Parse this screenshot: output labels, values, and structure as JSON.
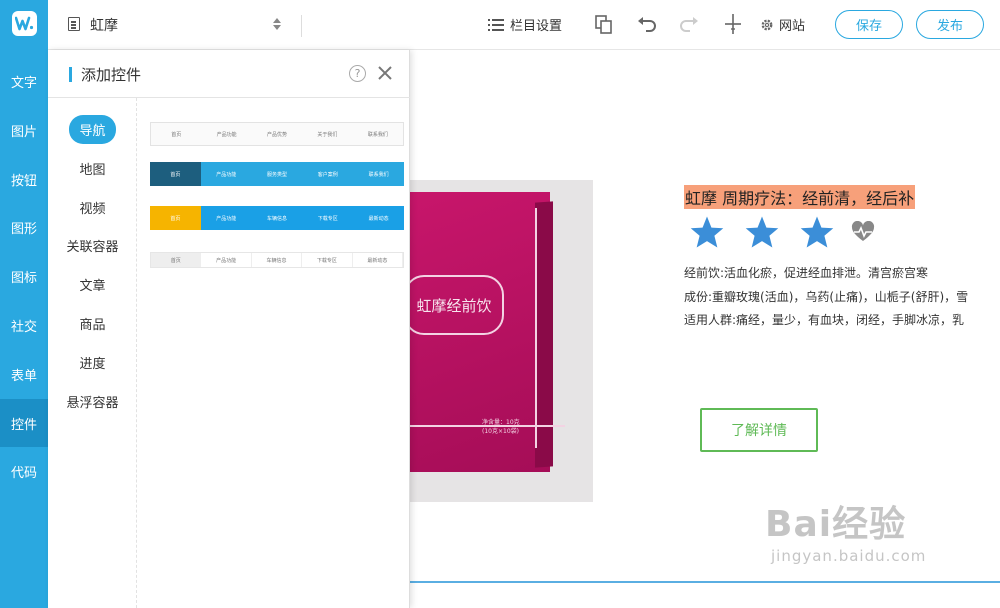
{
  "rail": {
    "items": [
      "文字",
      "图片",
      "按钮",
      "图形",
      "图标",
      "社交",
      "表单",
      "控件",
      "代码"
    ],
    "active": "控件",
    "accent": "#2aa8e0"
  },
  "topbar": {
    "doc_title": "虹摩",
    "column_settings": "栏目设置",
    "website": "网站",
    "save": "保存",
    "publish": "发布"
  },
  "panel": {
    "title": "添加控件",
    "help_symbol": "?",
    "categories": [
      "导航",
      "地图",
      "视频",
      "关联容器",
      "文章",
      "商品",
      "进度",
      "悬浮容器"
    ],
    "active_category": "导航",
    "nav_previews": [
      [
        "首页",
        "产品功能",
        "产品优势",
        "关于我们",
        "联系我们"
      ],
      [
        "首页",
        "产品功能",
        "服务类型",
        "客户案例",
        "联系我们"
      ],
      [
        "首页",
        "产品功能",
        "车辆信息",
        "下载专区",
        "最新动态"
      ],
      [
        "首页",
        "产品功能",
        "车辆信息",
        "下载专区",
        "最新动态"
      ]
    ]
  },
  "canvas": {
    "product_label": "虹摩经前饮",
    "product_small_text": [
      "净含量：10克",
      "(10克×10袋)"
    ],
    "headline": "虹摩 周期疗法：经前清，经后补",
    "rating": 3,
    "rating_max": 3,
    "desc_lines": [
      "经前饮:活血化瘀，促进经血排泄。清宫瘀宫寒",
      "成份:重瓣玫瑰(活血)，乌药(止痛)，山栀子(舒肝)，雪",
      "适用人群:痛经，量少，有血块，闭经，手脚冰凉，乳"
    ],
    "more_button": "了解详情",
    "more_color": "#5fba56",
    "watermark": "Bai经验",
    "watermark_url": "jingyan.baidu.com"
  }
}
